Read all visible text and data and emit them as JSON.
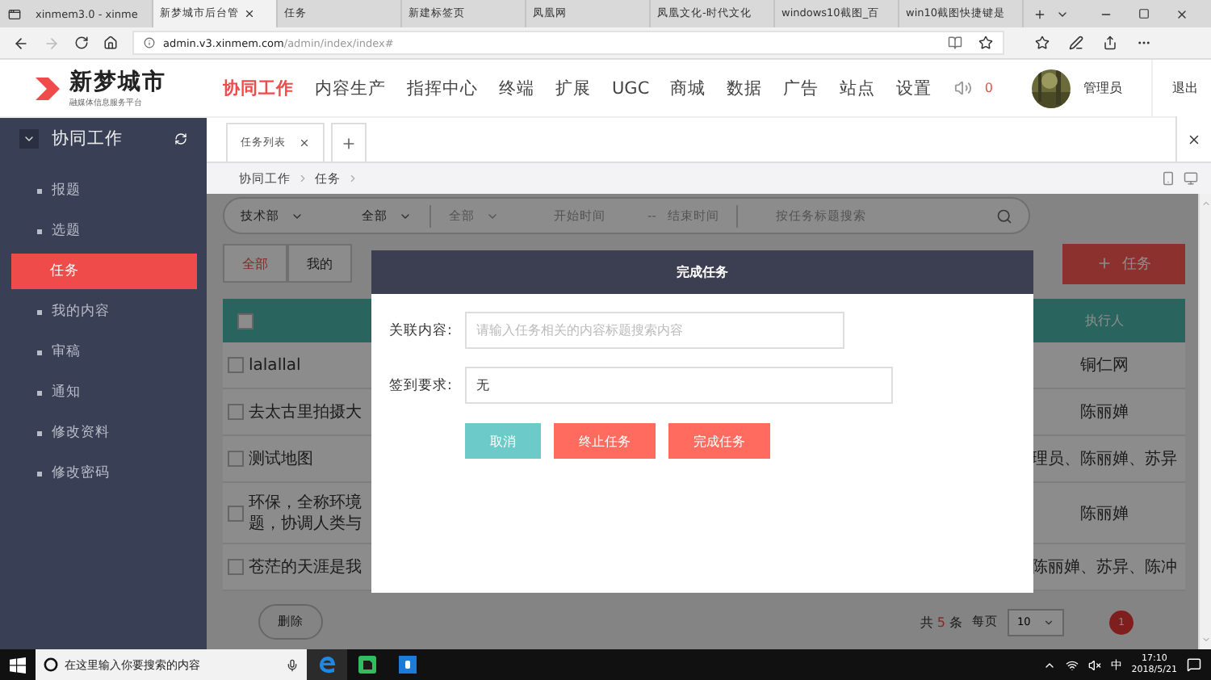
{
  "browser": {
    "tabs": [
      {
        "title": "xinmem3.0 - xinme",
        "selected": false
      },
      {
        "title": "新梦城市后台管",
        "selected": true
      },
      {
        "title": "任务",
        "selected": false
      },
      {
        "title": "新建标签页",
        "selected": false
      },
      {
        "title": "凤凰网",
        "selected": false
      },
      {
        "title": "凤凰文化-时代文化",
        "selected": false
      },
      {
        "title": "windows10截图_百",
        "selected": false
      },
      {
        "title": "win10截图快捷键是",
        "selected": false
      }
    ],
    "url": {
      "host": "admin.v3.xinmem.com",
      "path": "/admin/index/index#"
    }
  },
  "app": {
    "logo": {
      "name": "新梦城市",
      "subtitle": "融媒体信息服务平台"
    },
    "nav": [
      {
        "label": "协同工作",
        "selected": true
      },
      {
        "label": "内容生产",
        "selected": false
      },
      {
        "label": "指挥中心",
        "selected": false
      },
      {
        "label": "终端",
        "selected": false
      },
      {
        "label": "扩展",
        "selected": false
      },
      {
        "label": "UGC",
        "selected": false
      },
      {
        "label": "商城",
        "selected": false
      },
      {
        "label": "数据",
        "selected": false
      },
      {
        "label": "广告",
        "selected": false
      },
      {
        "label": "站点",
        "selected": false
      },
      {
        "label": "设置",
        "selected": false
      }
    ],
    "alert_count": "0",
    "user": "管理员",
    "logout": "退出"
  },
  "sidebar": {
    "title": "协同工作",
    "items": [
      {
        "label": "报题",
        "selected": false
      },
      {
        "label": "选题",
        "selected": false
      },
      {
        "label": "任务",
        "selected": true
      },
      {
        "label": "我的内容",
        "selected": false
      },
      {
        "label": "审稿",
        "selected": false
      },
      {
        "label": "通知",
        "selected": false
      },
      {
        "label": "修改资料",
        "selected": false
      },
      {
        "label": "修改密码",
        "selected": false
      }
    ]
  },
  "page_tabs": [
    {
      "label": "任务列表"
    }
  ],
  "breadcrumb": [
    "协同工作",
    "任务"
  ],
  "filters": {
    "department": "技术部",
    "scope": "全部",
    "status": "全部",
    "start": "开始时间",
    "separator": "--",
    "end": "结束时间",
    "search_placeholder": "按任务标题搜索"
  },
  "list_tabs": [
    {
      "label": "全部",
      "selected": true
    },
    {
      "label": "我的",
      "selected": false
    }
  ],
  "add_button": "任务",
  "table": {
    "executor_header": "执行人",
    "header_checked": false,
    "rows": [
      {
        "title": [
          "lalallal"
        ],
        "executor": "铜仁网",
        "checked": false
      },
      {
        "title": [
          "去太古里拍摄大"
        ],
        "executor": "陈丽婵",
        "checked": false
      },
      {
        "title": [
          "测试地图"
        ],
        "executor": "理员、陈丽婵、苏异",
        "checked": false
      },
      {
        "title": [
          "环保，全称环境",
          "题，协调人类与"
        ],
        "executor": "陈丽婵",
        "checked": false
      },
      {
        "title": [
          "苍茫的天涯是我"
        ],
        "executor": "陈丽婵、苏异、陈冲",
        "checked": false
      }
    ]
  },
  "footer": {
    "delete": "删除",
    "total_prefix": "共",
    "total": "5",
    "total_suffix": "条",
    "per_page_label": "每页",
    "per_page": "10",
    "pages": [
      {
        "label": "1",
        "selected": true
      }
    ]
  },
  "modal": {
    "title": "完成任务",
    "fields": [
      {
        "label": "关联内容:",
        "placeholder": "请输入任务相关的内容标题搜索内容"
      },
      {
        "label": "签到要求:",
        "value": "无"
      }
    ],
    "buttons": [
      {
        "label": "取消",
        "kind": "cancel"
      },
      {
        "label": "终止任务",
        "kind": "danger"
      },
      {
        "label": "完成任务",
        "kind": "danger"
      }
    ]
  },
  "taskbar": {
    "search_placeholder": "在这里输入你要搜索的内容",
    "ime": "中",
    "time": "17:10",
    "date": "2018/5/21"
  }
}
